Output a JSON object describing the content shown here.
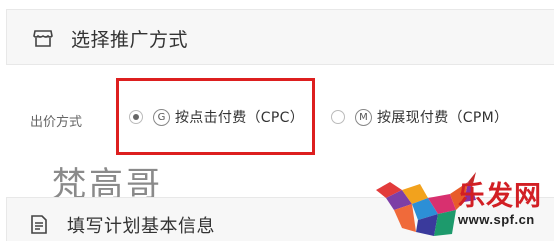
{
  "section1": {
    "title": "选择推广方式",
    "icon": "shop-icon"
  },
  "bid": {
    "label": "出价方式",
    "options": [
      {
        "letter": "G",
        "label": "按点击付费（CPC）",
        "selected": true
      },
      {
        "letter": "M",
        "label": "按展现付费（CPM）",
        "selected": false
      }
    ]
  },
  "section2": {
    "title": "填写计划基本信息",
    "icon": "document-icon"
  },
  "watermark": {
    "text": "梵高哥"
  },
  "logo": {
    "text": "乐发网",
    "url": "www.spf.cn"
  },
  "colors": {
    "highlight": "#dd1f1f",
    "logo_red": "#d21f24"
  }
}
